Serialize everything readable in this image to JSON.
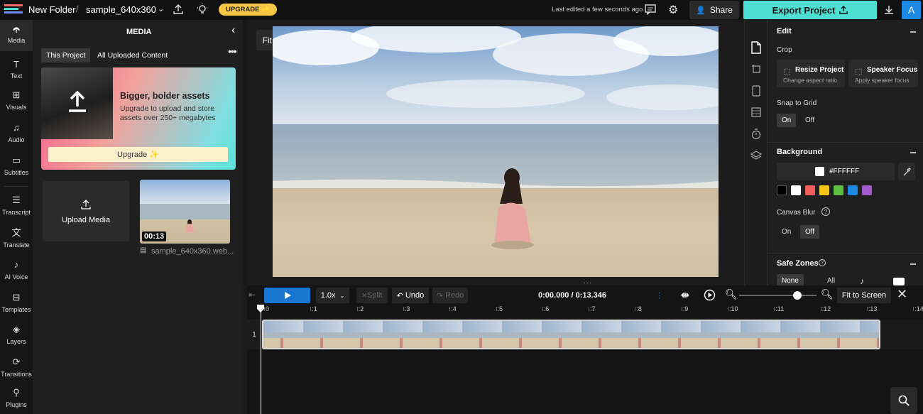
{
  "topbar": {
    "folder": "New Folder",
    "project": "sample_640x360",
    "upgrade": "UPGRADE ✨",
    "last_edited": "Last edited a few seconds ago",
    "share": "Share",
    "export": "Export Project",
    "avatar": "A"
  },
  "rail": {
    "items": [
      {
        "label": "Media",
        "icon": "media-icon"
      },
      {
        "label": "Text",
        "icon": "text-icon"
      },
      {
        "label": "Visuals",
        "icon": "visuals-icon"
      },
      {
        "label": "Audio",
        "icon": "audio-icon"
      },
      {
        "label": "Subtitles",
        "icon": "subtitles-icon"
      },
      {
        "label": "Transcript",
        "icon": "transcript-icon"
      },
      {
        "label": "Translate",
        "icon": "translate-icon"
      },
      {
        "label": "AI Voice",
        "icon": "ai-voice-icon"
      },
      {
        "label": "Templates",
        "icon": "templates-icon"
      },
      {
        "label": "Layers",
        "icon": "layers-icon"
      },
      {
        "label": "Transitions",
        "icon": "transitions-icon"
      },
      {
        "label": "Plugins",
        "icon": "plugins-icon"
      }
    ]
  },
  "media": {
    "title": "MEDIA",
    "tab_project": "This Project",
    "tab_all": "All Uploaded Content",
    "promo_title": "Bigger, bolder assets",
    "promo_line1": "Upgrade to upload and store",
    "promo_line2": "assets over 250+ megabytes",
    "promo_button": "Upgrade ✨",
    "upload": "Upload Media",
    "clip_duration": "00:13",
    "clip_name": "sample_640x360.web..."
  },
  "canvas": {
    "fit": "Fit"
  },
  "edit": {
    "title": "Edit",
    "crop": "Crop",
    "resize_title": "Resize Project",
    "resize_sub": "Change aspect ratio",
    "speaker_title": "Speaker Focus",
    "speaker_sub": "Apply speaker focus",
    "snap": "Snap to Grid",
    "on": "On",
    "off": "Off",
    "background": "Background",
    "bg_hex": "#FFFFFF",
    "swatches": [
      "#000000",
      "#ffffff",
      "#f25c5c",
      "#f5c518",
      "#5fbf3f",
      "#1e88e5",
      "#a259c9"
    ],
    "canvas_blur": "Canvas Blur",
    "safe_zones": "Safe Zones",
    "safe_none": "None",
    "safe_all": "All"
  },
  "timeline": {
    "speed": "1.0x",
    "split": "Split",
    "undo": "Undo",
    "redo": "Redo",
    "time": "0:00.000 / 0:13.346",
    "fit_screen": "Fit to Screen",
    "track": "1",
    "ruler": [
      "0",
      ":1",
      ":2",
      ":3",
      ":4",
      ":5",
      ":6",
      ":7",
      ":8",
      ":9",
      ":10",
      ":11",
      ":12",
      ":13",
      ":14"
    ]
  }
}
